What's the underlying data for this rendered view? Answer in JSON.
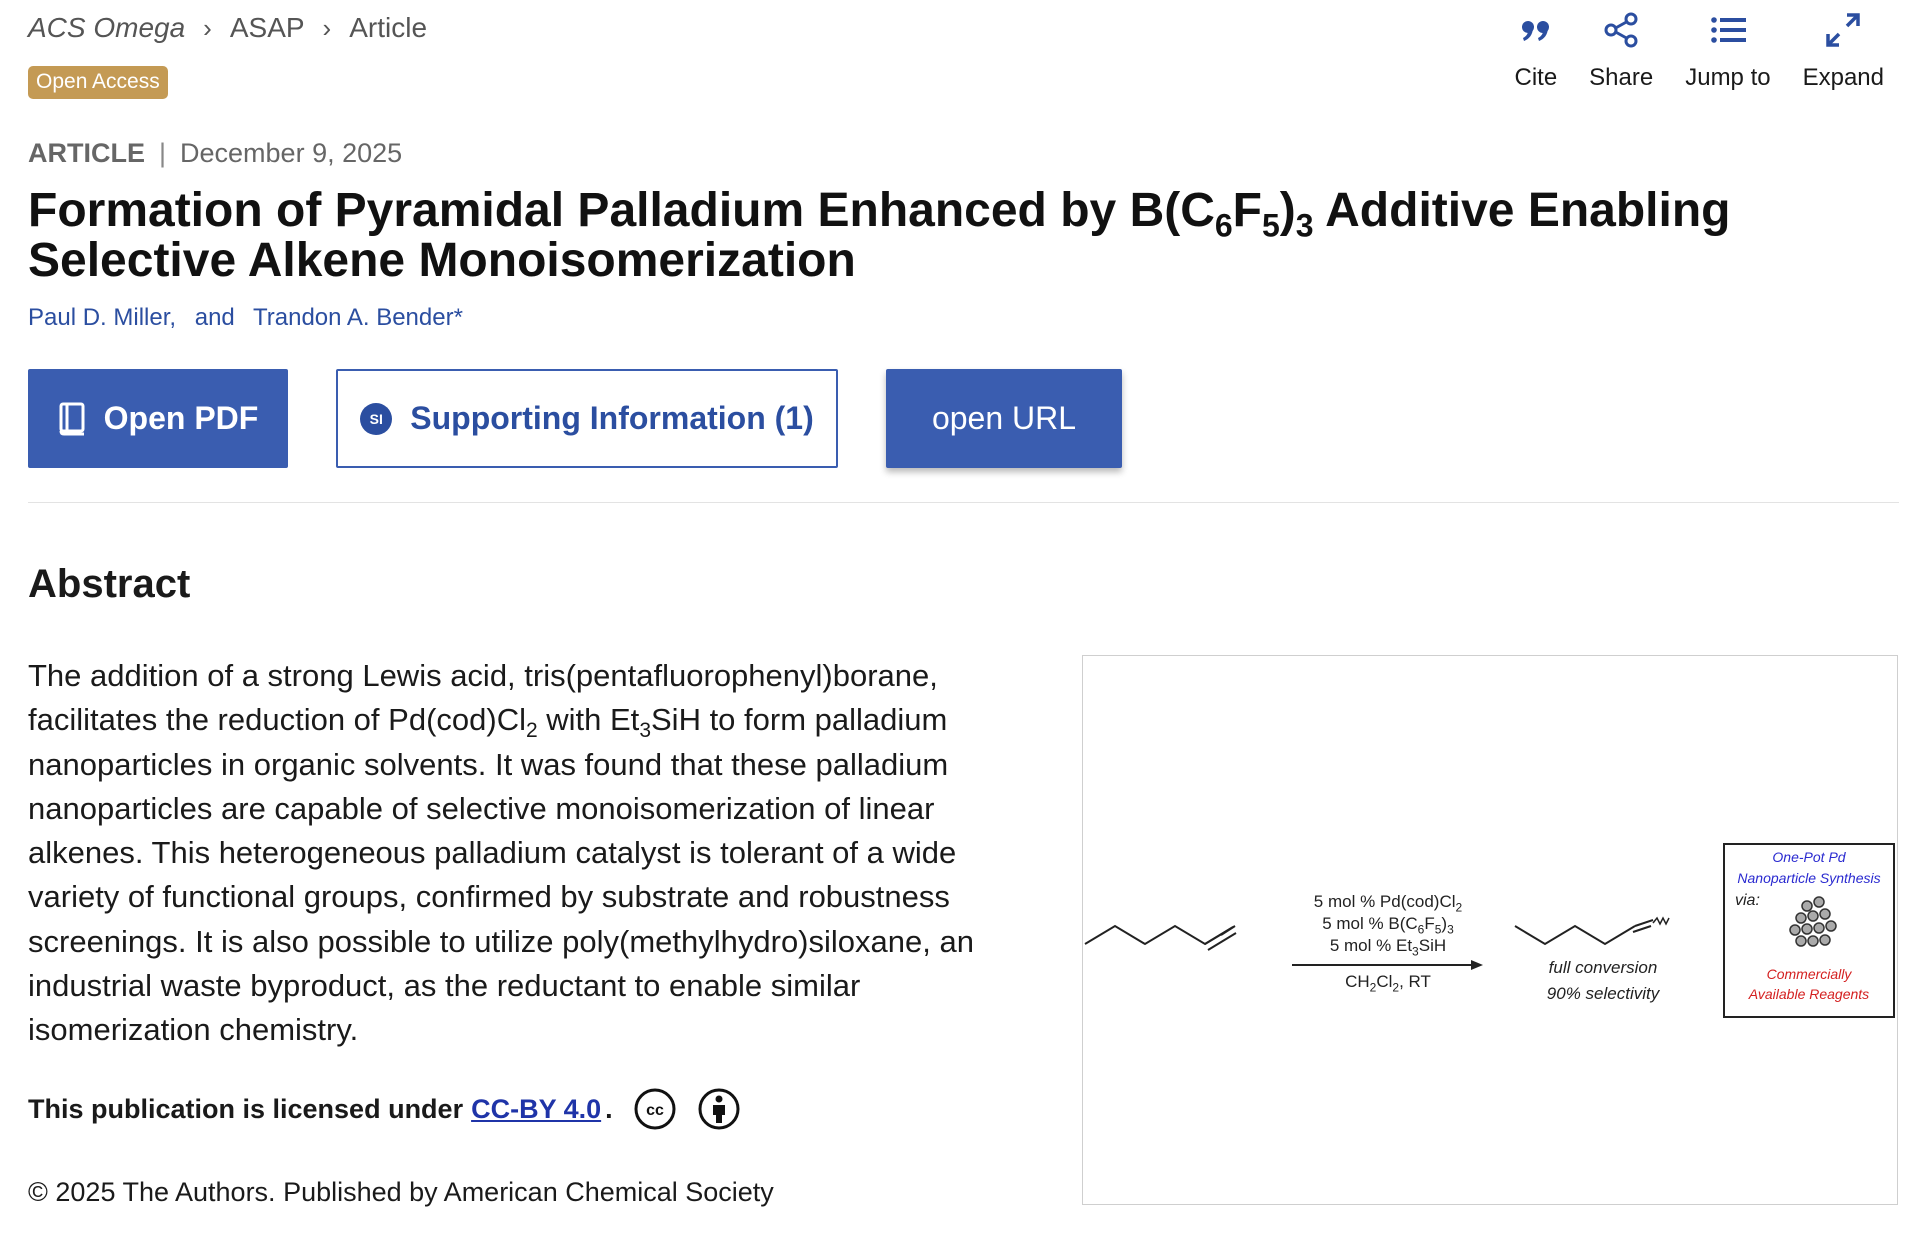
{
  "breadcrumb": {
    "journal": "ACS Omega",
    "section": "ASAP",
    "page": "Article"
  },
  "badge": "Open Access",
  "tools": [
    {
      "label": "Cite",
      "icon": "quote-icon"
    },
    {
      "label": "Share",
      "icon": "share-icon"
    },
    {
      "label": "Jump to",
      "icon": "list-icon"
    },
    {
      "label": "Expand",
      "icon": "expand-icon"
    }
  ],
  "article": {
    "type": "ARTICLE",
    "date": "December 9, 2025",
    "title_a": "Formation of Pyramidal Palladium Enhanced by B(C",
    "title_sub1": "6",
    "title_b": "F",
    "title_sub2": "5",
    "title_c": ")",
    "title_sub3": "3",
    "title_d": " Additive Enabling Selective Alkene Monoisomerization",
    "authors": [
      "Paul D. Miller,",
      "and",
      "Trandon A. Bender*"
    ]
  },
  "buttons": {
    "pdf": "Open PDF",
    "si_icon": "SI",
    "si": "Supporting Information (1)",
    "url": "open URL"
  },
  "abstract": {
    "heading": "Abstract",
    "t1": "The addition of a strong Lewis acid, tris(pentafluorophenyl)borane, facilitates the reduction of Pd(cod)Cl",
    "s1": "2",
    "t2": " with Et",
    "s2": "3",
    "t3": "SiH to form palladium nanoparticles in organic solvents. It was found that these palladium nanoparticles are capable of selective monoisomerization of linear alkenes. This heterogeneous palladium catalyst is tolerant of a wide variety of functional groups, confirmed by substrate and robustness screenings. It is also possible to utilize poly(methylhydro)siloxane, an industrial waste byproduct, as the reductant to enable similar isomerization chemistry."
  },
  "license": {
    "text": "This publication is licensed under",
    "link": "CC-BY 4.0",
    "dot": ".",
    "cc_icon": "cc-icon",
    "by_icon": "attribution-icon"
  },
  "copyright": "© 2025 The Authors. Published by American Chemical Society",
  "graphic": {
    "reagent1": "5 mol % Pd(cod)Cl",
    "reagent1_sub": "2",
    "reagent2_a": "5 mol % B(C",
    "reagent2_s1": "6",
    "reagent2_b": "F",
    "reagent2_s2": "5",
    "reagent2_c": ")",
    "reagent2_s3": "3",
    "reagent3_a": "5 mol % Et",
    "reagent3_s": "3",
    "reagent3_b": "SiH",
    "solvent_a": "CH",
    "solvent_s1": "2",
    "solvent_b": "Cl",
    "solvent_s2": "2",
    "solvent_c": ", RT",
    "result1": "full conversion",
    "result2": "90% selectivity",
    "box_line1": "One-Pot Pd",
    "box_line2": "Nanoparticle Synthesis",
    "box_via": "via:",
    "box_red1": "Commercially",
    "box_red2": "Available Reagents"
  },
  "colors": {
    "primary_button": "#3a5db0",
    "author_link": "#2b4ea0",
    "badge": "#c49a54",
    "license_link": "#1f34a8"
  }
}
